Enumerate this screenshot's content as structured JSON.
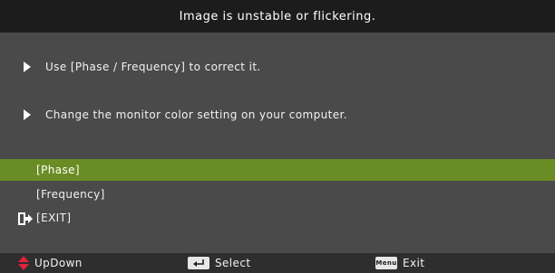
{
  "title": "Image is unstable or flickering.",
  "messages": [
    {
      "text": "Use [Phase / Frequency] to correct it.",
      "icon": "triangle-right-icon"
    },
    {
      "text": "Change the monitor color setting on your computer.",
      "icon": "triangle-right-icon"
    }
  ],
  "menu": {
    "items": [
      {
        "label": "[Phase]",
        "selected": true
      },
      {
        "label": "[Frequency]",
        "selected": false
      },
      {
        "label": "[EXIT]",
        "selected": false,
        "icon": "exit-door-icon"
      }
    ]
  },
  "footer": {
    "updown": {
      "label": "UpDown",
      "icon": "updown-arrows-icon"
    },
    "select": {
      "label": "Select",
      "icon": "enter-key-icon"
    },
    "exit": {
      "label": "Exit",
      "icon": "menu-key-icon",
      "key_text": "Menu"
    }
  },
  "colors": {
    "background": "#4a4a4a",
    "title_bar": "#1c1c1c",
    "selected_row": "#6a8c24",
    "footer": "#2e2e2e",
    "updown_icon": "#e0223a"
  }
}
